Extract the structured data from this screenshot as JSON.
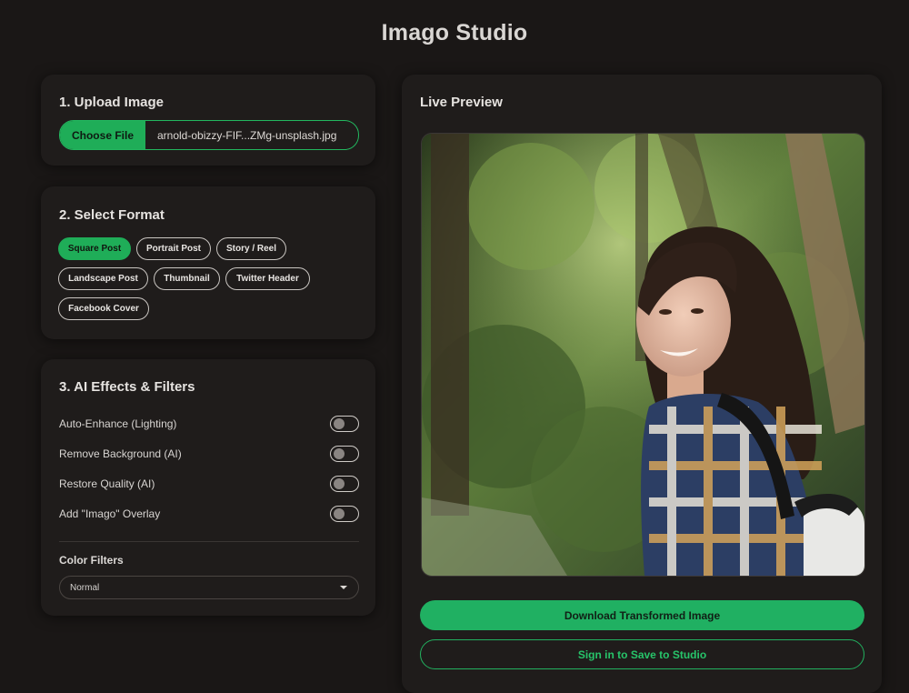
{
  "app": {
    "title": "Imago Studio"
  },
  "upload": {
    "heading": "1. Upload Image",
    "choose_label": "Choose File",
    "file_name": "arnold-obizzy-FIF...ZMg-unsplash.jpg"
  },
  "format": {
    "heading": "2. Select Format",
    "options": [
      "Square Post",
      "Portrait Post",
      "Story / Reel",
      "Landscape Post",
      "Thumbnail",
      "Twitter Header",
      "Facebook Cover"
    ],
    "selected": "Square Post"
  },
  "effects": {
    "heading": "3. AI Effects & Filters",
    "toggles": [
      {
        "label": "Auto-Enhance (Lighting)",
        "on": false
      },
      {
        "label": "Remove Background (AI)",
        "on": false
      },
      {
        "label": "Restore Quality (AI)",
        "on": false
      },
      {
        "label": "Add \"Imago\" Overlay",
        "on": false
      }
    ],
    "color_filters_label": "Color Filters",
    "color_filter_value": "Normal"
  },
  "preview": {
    "heading": "Live Preview",
    "download_label": "Download Transformed Image",
    "signin_label": "Sign in to Save to Studio"
  },
  "colors": {
    "background": "#1a1716",
    "card": "#1f1c1b",
    "accent": "#1fad58"
  }
}
